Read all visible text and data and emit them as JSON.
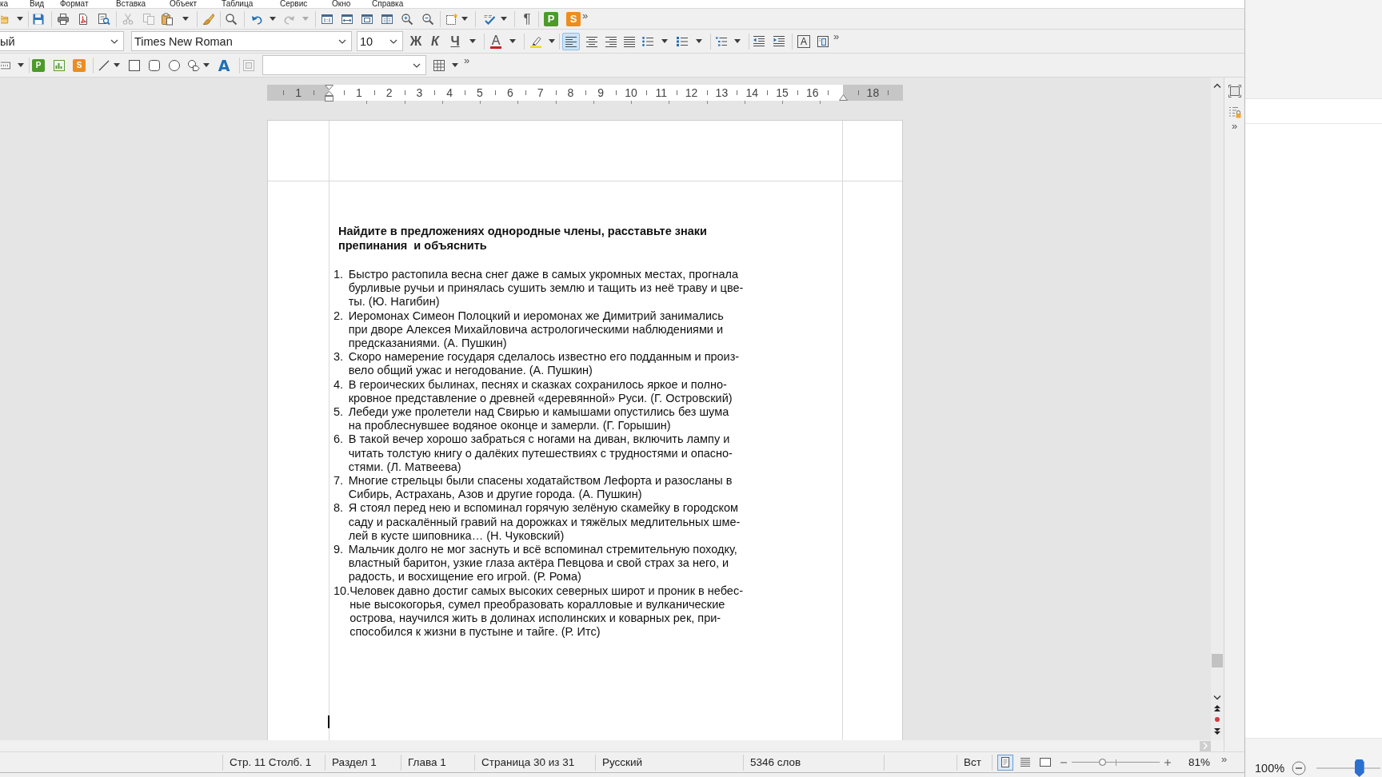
{
  "menu_bar": {
    "items": [
      "ка",
      "Вид",
      "Формат",
      "Вставка",
      "Объект",
      "Таблица",
      "Сервис",
      "Окно",
      "Справка"
    ]
  },
  "standard_toolbar": {
    "buttons": [
      {
        "disabled": false
      },
      {
        "disabled": false
      },
      {
        "disabled": false
      },
      {
        "disabled": false
      },
      {
        "disabled": false
      },
      {
        "disabled": true
      },
      {
        "disabled": true
      },
      {
        "disabled": false
      },
      {
        "disabled": false
      },
      {
        "disabled": false
      },
      {
        "disabled": false
      },
      {
        "disabled": true
      },
      {
        "disabled": false
      },
      {
        "disabled": false
      },
      {
        "disabled": false
      },
      {
        "disabled": false
      },
      {
        "disabled": false
      },
      {
        "disabled": false
      },
      {
        "disabled": false
      },
      {
        "disabled": false
      }
    ],
    "formatting_marks": "¶",
    "extensions": [
      "P",
      "S"
    ],
    "overflow": "»"
  },
  "formatting_toolbar": {
    "paragraph_style": "ый",
    "font_name": "Times New Roman",
    "font_size": "10",
    "text_styles": [
      {
        "label": "Ж",
        "selected": false
      },
      {
        "label": "К",
        "selected": false
      },
      {
        "label": "Ч",
        "selected": false
      }
    ],
    "font_color": "A",
    "alignment": [
      {
        "selected": true
      },
      {
        "selected": false
      },
      {
        "selected": false
      },
      {
        "selected": false
      }
    ],
    "character": "A",
    "overflow": "»"
  },
  "drawing_toolbar": {
    "buttons": [
      {
        "disabled": false
      },
      {
        "disabled": false
      },
      {
        "disabled": false
      },
      {
        "disabled": false
      },
      {
        "disabled": false
      },
      {
        "disabled": false
      },
      {
        "disabled": false
      },
      {
        "disabled": true
      },
      {
        "disabled": false
      }
    ],
    "object_tiles": [
      "P",
      "S"
    ],
    "fontwork": "A",
    "overflow": "»"
  },
  "ruler": {
    "left_margin_labels": [
      "1"
    ],
    "labels": [
      "1",
      "2",
      "3",
      "4",
      "5",
      "6",
      "7",
      "8",
      "9",
      "10",
      "11",
      "12",
      "13",
      "14",
      "15",
      "16"
    ],
    "right_margin_labels": [
      "18"
    ]
  },
  "document": {
    "heading": "Найдите в предложениях однородные члены, расставьте знаки\nпрепинания  и объяснить",
    "items": [
      {
        "number": "1.",
        "text": "Быстро растопила весна снег даже в самых укромных местах, прогнала\nбурливые ручьи и принялась сушить землю и тащить из неё траву и цве-\nты. (Ю. Нагибин)"
      },
      {
        "number": "2.",
        "text": "Иеромонах Симеон Полоцкий и иеромонах же Димитрий занимались\nпри дворе Алексея Михайловича астрологическими наблюдениями и\nпредсказаниями. (А. Пушкин)"
      },
      {
        "number": "3.",
        "text": "Скоро намерение государя сделалось известно его подданным и произ-\nвело общий ужас и негодование. (А. Пушкин)"
      },
      {
        "number": "4.",
        "text": "В героических былинах, песнях и сказках сохранилось яркое и полно-\nкровное представление о древней «деревянной» Руси. (Г. Островский)"
      },
      {
        "number": "5.",
        "text": "Лебеди уже пролетели над Свирью и камышами опустились без шума\nна проблеснувшее водяное оконце и замерли. (Г. Горышин)"
      },
      {
        "number": "6.",
        "text": "В такой вечер хорошо забраться с ногами на диван, включить лампу и\nчитать толстую книгу о далёких путешествиях с трудностями и опасно-\nстями. (Л. Матвеева)"
      },
      {
        "number": "7.",
        "text": "Многие стрельцы были спасены ходатайством Лефорта и разосланы в\nСибирь, Астрахань, Азов и другие города. (А. Пушкин)"
      },
      {
        "number": "8.",
        "text": "Я стоял перед нею и вспоминал горячую зелёную скамейку в городском\nсаду и раскалённый гравий на дорожках и тяжёлых медлительных шме-\nлей в кусте шиповника… (Н. Чуковский)"
      },
      {
        "number": "9.",
        "text": "Мальчик долго не мог заснуть и всё вспоминал стремительную походку,\nвластный баритон, узкие глаза актёра Певцова и свой страх за него, и\nрадость, и восхищение его игрой. (Р. Рома)"
      },
      {
        "number": "10.",
        "text": "Человек давно достиг самых высоких северных широт и проник в небес-\nные высокогорья, сумел преобразовать коралловые и вулканические\nострова, научился жить в долинах исполинских и коварных рек, при-\nспособился к жизни в пустыне и тайге. (Р. Итс)"
      }
    ]
  },
  "sidebar": {
    "overflow": "»"
  },
  "status_bar": {
    "fields": [
      "Стр. 11 Столб. 1",
      "Раздел 1",
      "Глава 1",
      "Страница 30 из 31",
      "Русский",
      "5346 слов"
    ],
    "insert_mode": "Вст",
    "view_layouts": [
      {
        "selected": true
      },
      {
        "selected": false
      },
      {
        "selected": false
      }
    ],
    "zoom_slider": {
      "level": 0.35
    },
    "zoom": "81%",
    "overflow": "»"
  },
  "side_window": {
    "zoom": "100%",
    "zoom_slider": {
      "level": 0.67
    }
  }
}
